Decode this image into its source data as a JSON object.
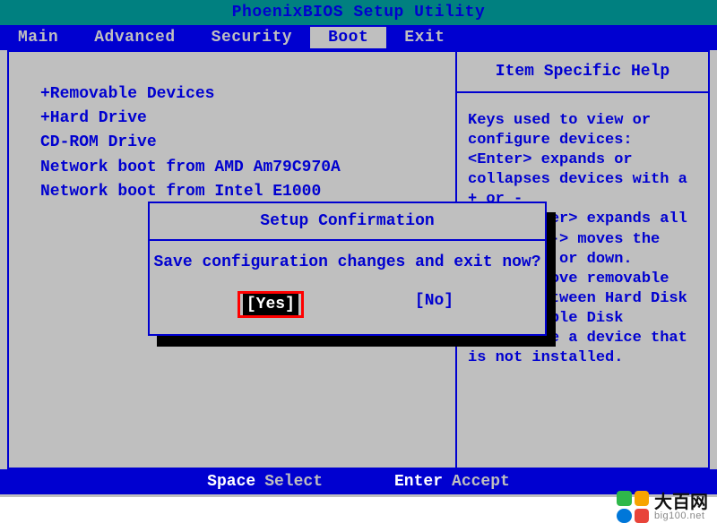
{
  "title": "PhoenixBIOS Setup Utility",
  "menu": {
    "items": [
      "Main",
      "Advanced",
      "Security",
      "Boot",
      "Exit"
    ],
    "active_index": 3
  },
  "boot_list": [
    "+Removable Devices",
    "+Hard Drive",
    " CD-ROM Drive",
    " Network boot from AMD Am79C970A",
    " Network boot from Intel E1000"
  ],
  "help": {
    "title": "Item Specific Help",
    "body": "Keys used to view or configure devices:\n<Enter> expands or collapses devices with a + or -\n<Ctrl+Enter> expands all\n<+> and <-> moves the device up or down.\n<n> May move removable device between Hard Disk or Removable Disk\n<d> Remove a device that is not installed."
  },
  "dialog": {
    "title": "Setup Confirmation",
    "message": "Save configuration changes and exit now?",
    "yes_label": "[Yes]",
    "no_label": "[No]",
    "selected": "yes"
  },
  "footer": {
    "items": [
      {
        "key": "Space",
        "label": "Select"
      },
      {
        "key": "Enter",
        "label": "Accept"
      }
    ]
  },
  "watermark": {
    "text": "大百网",
    "url": "big100.net"
  }
}
